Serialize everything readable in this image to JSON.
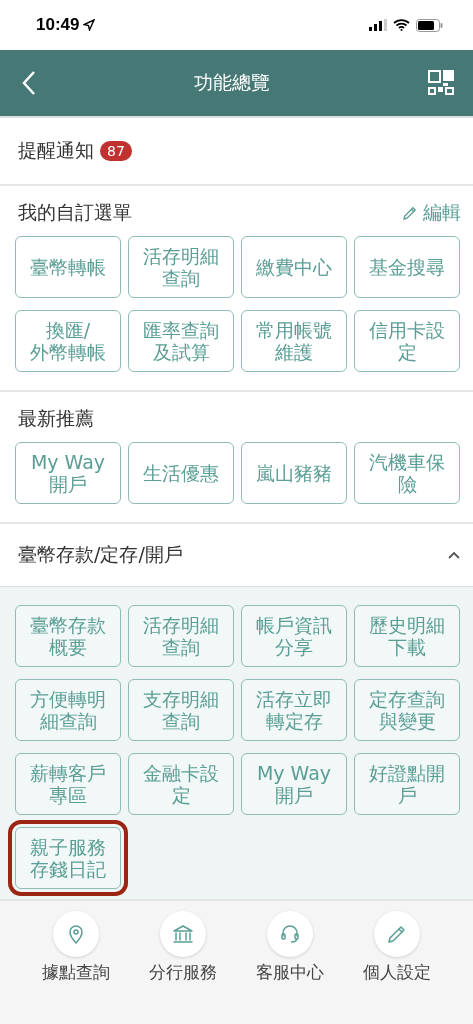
{
  "status_bar": {
    "time": "10:49"
  },
  "header": {
    "title": "功能總覽"
  },
  "notifications": {
    "label": "提醒通知",
    "count": "87"
  },
  "sections": [
    {
      "title": "我的自訂選單",
      "action": "編輯",
      "items": [
        {
          "label": "臺幣轉帳"
        },
        {
          "label": "活存明細查詢"
        },
        {
          "label": "繳費中心"
        },
        {
          "label": "基金搜尋"
        },
        {
          "label": "換匯/\n外幣轉帳"
        },
        {
          "label": "匯率查詢及試算"
        },
        {
          "label": "常用帳號維護"
        },
        {
          "label": "信用卡設定"
        }
      ]
    },
    {
      "title": "最新推薦",
      "items": [
        {
          "label": "My Way\n開戶"
        },
        {
          "label": "生活優惠"
        },
        {
          "label": "嵐山豬豬"
        },
        {
          "label": "汽機車保險"
        }
      ]
    },
    {
      "title": "臺幣存款/定存/開戶",
      "expanded": true,
      "items": [
        {
          "label": "臺幣存款概要",
          "highlighted": false
        },
        {
          "label": "活存明細查詢",
          "highlighted": false
        },
        {
          "label": "帳戶資訊分享",
          "highlighted": false
        },
        {
          "label": "歷史明細下載",
          "highlighted": false
        },
        {
          "label": "方便轉明細查詢",
          "highlighted": false
        },
        {
          "label": "支存明細查詢",
          "highlighted": false
        },
        {
          "label": "活存立即轉定存",
          "highlighted": false
        },
        {
          "label": "定存查詢與變更",
          "highlighted": false
        },
        {
          "label": "薪轉客戶專區",
          "highlighted": false
        },
        {
          "label": "金融卡設定",
          "highlighted": false
        },
        {
          "label": "My Way\n開戶",
          "highlighted": false
        },
        {
          "label": "好證點開戶",
          "highlighted": false
        },
        {
          "label": "親子服務存錢日記",
          "highlighted": true
        }
      ]
    }
  ],
  "bottom_nav": [
    {
      "kind": "pin",
      "label": "據點查詢"
    },
    {
      "kind": "bank",
      "label": "分行服務"
    },
    {
      "kind": "headset",
      "label": "客服中心"
    },
    {
      "kind": "pencil",
      "label": "個人設定"
    }
  ]
}
